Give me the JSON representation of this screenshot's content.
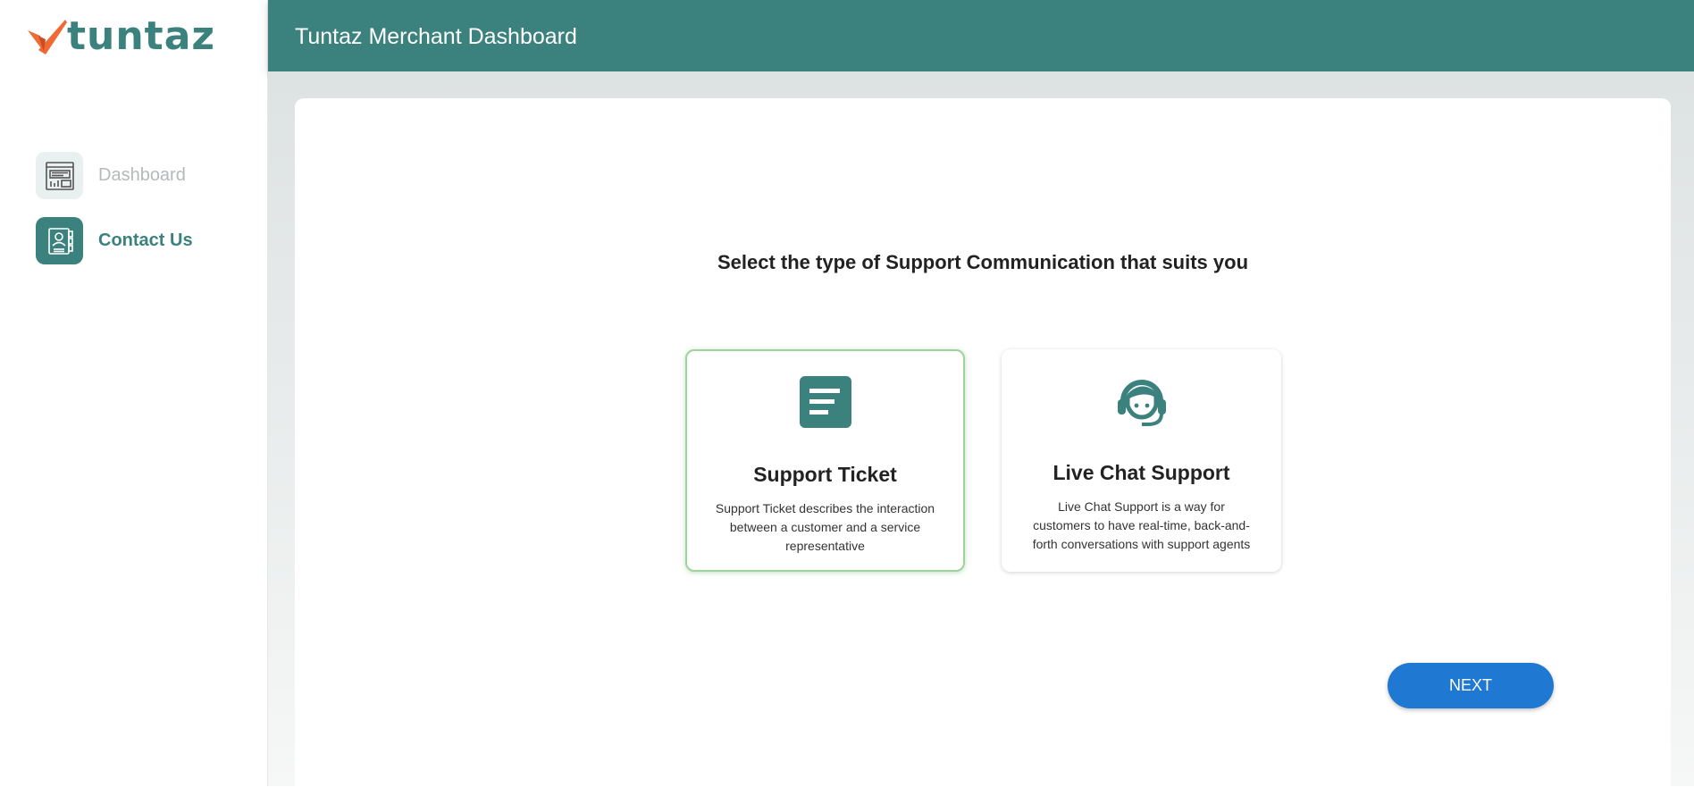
{
  "brand": {
    "logo_text": "tuntaz",
    "accent": "#3b827e",
    "logo_mark_color": "#f06a35"
  },
  "sidebar": {
    "items": [
      {
        "label": "Dashboard",
        "icon": "dashboard-icon",
        "active": false
      },
      {
        "label": "Contact Us",
        "icon": "contact-book-icon",
        "active": true
      }
    ]
  },
  "header": {
    "title": "Tuntaz Merchant Dashboard"
  },
  "main": {
    "heading": "Select the type of Support Communication that suits you",
    "options": [
      {
        "title": "Support Ticket",
        "description": "Support Ticket describes the interaction between a customer and a service representative",
        "icon": "document-icon",
        "selected": true
      },
      {
        "title": "Live Chat Support",
        "description": "Live Chat Support is a way for customers to have real-time, back-and-forth conversations with support agents",
        "icon": "headset-agent-icon",
        "selected": false
      }
    ],
    "next_label": "NEXT",
    "next_color": "#1f78d1"
  }
}
